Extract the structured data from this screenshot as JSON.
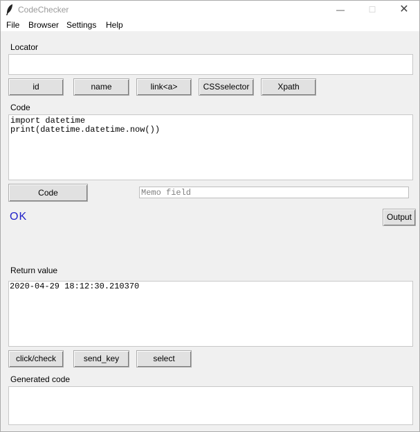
{
  "window": {
    "title": "CodeChecker"
  },
  "menu": [
    "File",
    "Browser",
    "Settings",
    "Help"
  ],
  "locator": {
    "label": "Locator",
    "value": ""
  },
  "locator_buttons": [
    "id",
    "name",
    "link<a>",
    "CSSselector",
    "Xpath"
  ],
  "code": {
    "label": "Code",
    "lines": [
      "import datetime",
      "print(datetime.datetime.now())"
    ]
  },
  "code_button": "Code",
  "memo": {
    "placeholder": "Memo field",
    "value": ""
  },
  "status": {
    "text": "OK",
    "color": "#2121c8"
  },
  "output_button": "Output",
  "return_value": {
    "label": "Return value",
    "text": "2020-04-29 18:12:30.210370"
  },
  "action_buttons": [
    "click/check",
    "send_key",
    "select"
  ],
  "generated_code": {
    "label": "Generated code",
    "text": ""
  }
}
